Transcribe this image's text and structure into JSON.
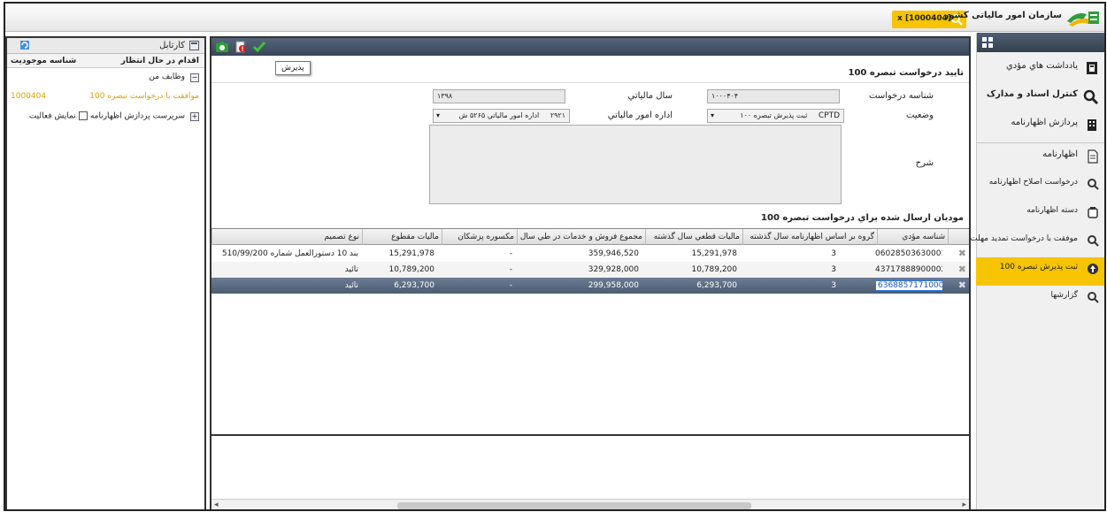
{
  "header": {
    "org_name": "سازمان امور مالیاتی کشور",
    "search_value": "x [1000404]"
  },
  "nav": {
    "items": [
      {
        "label": "يادداشت هاي مؤدي"
      },
      {
        "label": "کنترل اسناد و مدارک"
      },
      {
        "label": "پردازش اظهارنامه"
      },
      {
        "label": "اظهارنامه"
      },
      {
        "label": "درخواست اصلاح اظهارنامه"
      },
      {
        "label": "دسته اظهارنامه"
      },
      {
        "label": "موفقت با درخواست تمدید مهلت"
      },
      {
        "label": "ثبت پذيرش تبصره 100"
      },
      {
        "label": "گزارشها"
      }
    ]
  },
  "cartable": {
    "title": "کارتابل",
    "col_action": "اقدام در حال انتظار",
    "col_id": "شناسه موجوديت",
    "rows": [
      {
        "text": "وظايف من"
      },
      {
        "text": "موافقت با درخواست تبصره 100",
        "code": "1000404"
      },
      {
        "text": "سرپرست پردازش اظهارنامه",
        "extra": "نمايش فعاليت"
      }
    ]
  },
  "main": {
    "tooltip": "پذيرش",
    "form_title": "تاييد درخواست تبصره 100",
    "labels": {
      "request_id": "شناسه درخواست",
      "tax_year": "سال مالياتي",
      "status": "وضعيت",
      "tax_office": "اداره امور مالياتي",
      "description": "شرح"
    },
    "values": {
      "request_id": "۱۰۰۰۴۰۴",
      "tax_year": "۱۳۹۸",
      "status_code": "CPTD",
      "status_text": "ثبت پذيرش تبصره ۱۰۰",
      "office_code": "۲۹۲۱",
      "office_text": "اداره امور مالياتي ۵۲۶۵ ش"
    },
    "grid_title": "موديان ارسال شده براي درخواست تبصره 100",
    "columns": {
      "taxpayer_id": "شناسه مؤدي",
      "group": "گروه بر اساس اظهارنامه سال گذشته",
      "final_tax": "ماليات قطعي سال گذشته",
      "total_sales": "مجموع فروش و خدمات در طي سال",
      "medical": "مکسوره پزشکان",
      "settled_tax": "ماليات مقطوع",
      "decision": "نوع تصميم"
    },
    "rows": [
      {
        "taxpayer_id": "06028503630001",
        "group": "3",
        "final_tax": "15,291,978",
        "total_sales": "359,946,520",
        "medical": "-",
        "settled_tax": "15,291,978",
        "decision": "بند 10 دستورالعمل شماره 510/99/200"
      },
      {
        "taxpayer_id": "43717888900002",
        "group": "3",
        "final_tax": "10,789,200",
        "total_sales": "329,928,000",
        "medical": "-",
        "settled_tax": "10,789,200",
        "decision": "تائيد"
      },
      {
        "taxpayer_id": "63688571710001",
        "group": "3",
        "final_tax": "6,293,700",
        "total_sales": "299,958,000",
        "medical": "-",
        "settled_tax": "6,293,700",
        "decision": "تائيد"
      }
    ]
  }
}
